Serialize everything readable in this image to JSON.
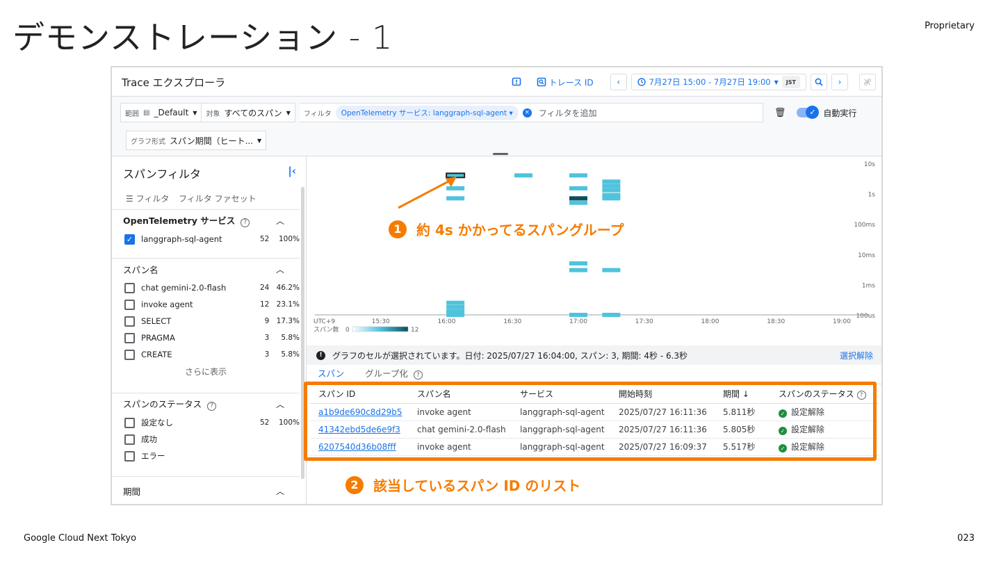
{
  "slide": {
    "title": "デモンストレーション - 1",
    "proprietary": "Proprietary",
    "footer_left": "Google Cloud Next Tokyo",
    "page_number": "023"
  },
  "header": {
    "title": "Trace エクスプローラ",
    "trace_id_label": "トレース ID",
    "time_range": "7月27日 15:00 - 7月27日 19:00",
    "timezone": "JST"
  },
  "filterbar": {
    "scope_label": "範囲",
    "scope_value": "_Default",
    "target_label": "対象",
    "target_value": "すべてのスパン",
    "filter_label": "フィルタ",
    "filter_chip": "OpenTelemetry サービス: langgraph-sql-agent",
    "filter_placeholder": "フィルタを追加",
    "auto_run": "自動実行",
    "graph_type_label": "グラフ形式",
    "graph_type_value": "スパン期間（ヒート..."
  },
  "sidebar": {
    "title": "スパンフィルタ",
    "tab_filter": "フィルタ",
    "tab_facet": "フィルタ ファセット",
    "services": {
      "title": "OpenTelemetry サービス",
      "items": [
        {
          "name": "langgraph-sql-agent",
          "count": "52",
          "pct": "100%",
          "checked": true
        }
      ]
    },
    "span_names": {
      "title": "スパン名",
      "items": [
        {
          "name": "chat gemini-2.0-flash",
          "count": "24",
          "pct": "46.2%"
        },
        {
          "name": "invoke agent",
          "count": "12",
          "pct": "23.1%"
        },
        {
          "name": "SELECT",
          "count": "9",
          "pct": "17.3%"
        },
        {
          "name": "PRAGMA",
          "count": "3",
          "pct": "5.8%"
        },
        {
          "name": "CREATE",
          "count": "3",
          "pct": "5.8%"
        }
      ],
      "show_more": "さらに表示"
    },
    "status": {
      "title": "スパンのステータス",
      "items": [
        {
          "name": "設定なし",
          "count": "52",
          "pct": "100%"
        },
        {
          "name": "成功",
          "count": "",
          "pct": ""
        },
        {
          "name": "エラー",
          "count": "",
          "pct": ""
        }
      ]
    },
    "duration": {
      "title": "期間"
    }
  },
  "chart_data": {
    "type": "heatmap",
    "title": "",
    "x_ticks": [
      "15:30",
      "16:00",
      "16:30",
      "17:00",
      "17:30",
      "18:00",
      "18:30",
      "19:00"
    ],
    "x_range": [
      "15:00",
      "19:00"
    ],
    "x_start_label": "UTC+9",
    "y_ticks": [
      "10s",
      "1s",
      "100ms",
      "10ms",
      "1ms",
      "100us"
    ],
    "legend_label": "スパン数",
    "legend_min": "0",
    "legend_max": "12",
    "colors": {
      "light": "#4fc3dc",
      "dark": "#0b4f5c"
    },
    "cells": [
      {
        "time": "16:04",
        "duration": "4s",
        "count": 3,
        "selected": true
      },
      {
        "time": "16:04",
        "duration": "1.5s",
        "count": 1
      },
      {
        "time": "16:04",
        "duration": "700ms",
        "count": 1
      },
      {
        "time": "16:04",
        "duration": "250us",
        "count": 1
      },
      {
        "time": "16:04",
        "duration": "180us",
        "count": 1
      },
      {
        "time": "16:04",
        "duration": "130us",
        "count": 1
      },
      {
        "time": "16:04",
        "duration": "100us",
        "count": 1
      },
      {
        "time": "16:35",
        "duration": "4s",
        "count": 1
      },
      {
        "time": "17:00",
        "duration": "4s",
        "count": 1
      },
      {
        "time": "17:00",
        "duration": "1.5s",
        "count": 1
      },
      {
        "time": "17:00",
        "duration": "700ms",
        "count": 12
      },
      {
        "time": "17:00",
        "duration": "500ms",
        "count": 1
      },
      {
        "time": "17:00",
        "duration": "5ms",
        "count": 1
      },
      {
        "time": "17:00",
        "duration": "3ms",
        "count": 1
      },
      {
        "time": "17:00",
        "duration": "100us",
        "count": 1
      },
      {
        "time": "17:15",
        "duration": "2.5s",
        "count": 1
      },
      {
        "time": "17:15",
        "duration": "1.8s",
        "count": 1
      },
      {
        "time": "17:15",
        "duration": "1.3s",
        "count": 1
      },
      {
        "time": "17:15",
        "duration": "900ms",
        "count": 1
      },
      {
        "time": "17:15",
        "duration": "700ms",
        "count": 1
      },
      {
        "time": "17:15",
        "duration": "3ms",
        "count": 1
      },
      {
        "time": "17:15",
        "duration": "100us",
        "count": 1
      }
    ]
  },
  "info_bar": {
    "message": "グラフのセルが選択されています。日付: 2025/07/27 16:04:00, スパン: 3, 期間: 4秒 - 6.3秒",
    "clear": "選択解除"
  },
  "tabs": {
    "span": "スパン",
    "group": "グループ化"
  },
  "table": {
    "headers": [
      "スパン ID",
      "スパン名",
      "サービス",
      "開始時刻",
      "期間",
      "スパンのステータス"
    ],
    "rows": [
      {
        "id": "a1b9de690c8d29b5",
        "name": "invoke agent",
        "service": "langgraph-sql-agent",
        "start": "2025/07/27 16:11:36",
        "duration": "5.811秒",
        "status": "設定解除"
      },
      {
        "id": "41342ebd5de6e9f3",
        "name": "chat gemini-2.0-flash",
        "service": "langgraph-sql-agent",
        "start": "2025/07/27 16:11:36",
        "duration": "5.805秒",
        "status": "設定解除"
      },
      {
        "id": "6207540d36b08fff",
        "name": "invoke agent",
        "service": "langgraph-sql-agent",
        "start": "2025/07/27 16:09:37",
        "duration": "5.517秒",
        "status": "設定解除"
      }
    ]
  },
  "annotations": {
    "a1_num": "1",
    "a1_text": "約 4s かかってるスパングループ",
    "a2_num": "2",
    "a2_text": "該当しているスパン ID のリスト"
  },
  "accent_colors": {
    "brand": "#1a73e8",
    "annotation": "#f57c00",
    "success": "#1e8e3e"
  }
}
